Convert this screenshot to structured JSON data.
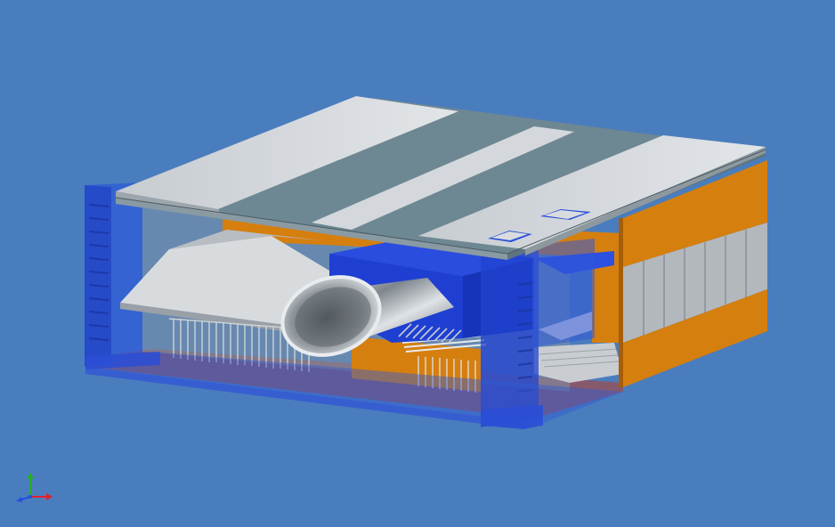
{
  "viewport": {
    "background_color": "#4a7dbd"
  },
  "model": {
    "colors": {
      "roof_light": "#d9dcdf",
      "roof_dark": "#6f8a94",
      "orange": "#d57f0f",
      "orange_dark": "#a85e07",
      "translucent_blue": "#2f5bd8",
      "solid_blue": "#1d3fd0",
      "grey_panel": "#c8ccd0",
      "floor_red": "#b55a4a",
      "pipe_metal": "#9aa0a6"
    }
  },
  "view_triad": {
    "x_axis_color": "#e0202a",
    "y_axis_color": "#25b025",
    "z_axis_color": "#2050e0",
    "icon": "axis-triad-icon"
  }
}
